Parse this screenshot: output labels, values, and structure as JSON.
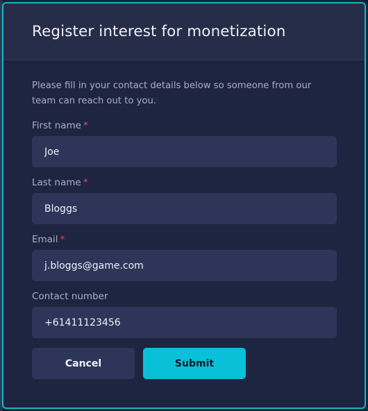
{
  "dialog": {
    "title": "Register interest for monetization",
    "intro": "Please fill in your contact details below so someone from our team can reach out to you."
  },
  "form": {
    "first_name": {
      "label": "First name",
      "required_mark": "*",
      "value": "Joe"
    },
    "last_name": {
      "label": "Last name",
      "required_mark": "*",
      "value": "Bloggs"
    },
    "email": {
      "label": "Email",
      "required_mark": "*",
      "value": "j.bloggs@game.com"
    },
    "contact_number": {
      "label": "Contact number",
      "value": "+61411123456"
    }
  },
  "actions": {
    "cancel_label": "Cancel",
    "submit_label": "Submit"
  },
  "colors": {
    "accent": "#0ac0d8",
    "required": "#e0495a",
    "dialog_bg": "#1e2540",
    "input_bg": "#2d3659"
  }
}
